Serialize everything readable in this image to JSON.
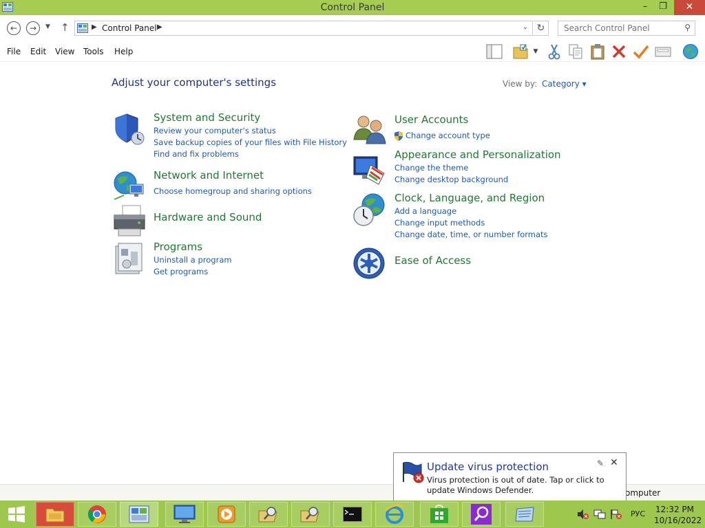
{
  "window": {
    "title": "Control Panel",
    "min": "–",
    "max": "❐",
    "close": "✕"
  },
  "address": {
    "crumb": "Control Panel",
    "search_placeholder": "Search Control Panel"
  },
  "menu": [
    "File",
    "Edit",
    "View",
    "Tools",
    "Help"
  ],
  "content": {
    "heading": "Adjust your computer's settings",
    "view_by_label": "View by:",
    "view_by_value": "Category ▾",
    "left_categories": [
      {
        "title": "System and Security",
        "links": [
          "Review your computer's status",
          "Save backup copies of your files with File History",
          "Find and fix problems"
        ]
      },
      {
        "title": "Network and Internet",
        "links": [
          "Choose homegroup and sharing options"
        ]
      },
      {
        "title": "Hardware and Sound",
        "links": []
      },
      {
        "title": "Programs",
        "links": [
          "Uninstall a program",
          "Get programs"
        ]
      }
    ],
    "right_categories": [
      {
        "title": "User Accounts",
        "links": [
          "Change account type"
        ]
      },
      {
        "title": "Appearance and Personalization",
        "links": [
          "Change the theme",
          "Change desktop background"
        ]
      },
      {
        "title": "Clock, Language, and Region",
        "links": [
          "Add a language",
          "Change input methods",
          "Change date, time, or number formats"
        ]
      },
      {
        "title": "Ease of Access",
        "links": []
      }
    ]
  },
  "notification": {
    "title": "Update virus protection",
    "body": "Virus protection is out of date. Tap or click to update Windows Defender.",
    "status_peek": "omputer"
  },
  "taskbar": {
    "apps": [
      "file-explorer",
      "chrome",
      "control-panel",
      "computer",
      "media-player",
      "search-folder-1",
      "search-folder-2",
      "command-prompt",
      "internet-explorer",
      "store",
      "search",
      "file-manager"
    ],
    "lang": "РУС",
    "time": "12:32 PM",
    "date": "10/16/2022"
  },
  "colors": {
    "accent": "#9dc84d",
    "title_green": "#1e7a31",
    "link_blue": "#1e5bb3",
    "heading_blue": "#1e3287"
  }
}
